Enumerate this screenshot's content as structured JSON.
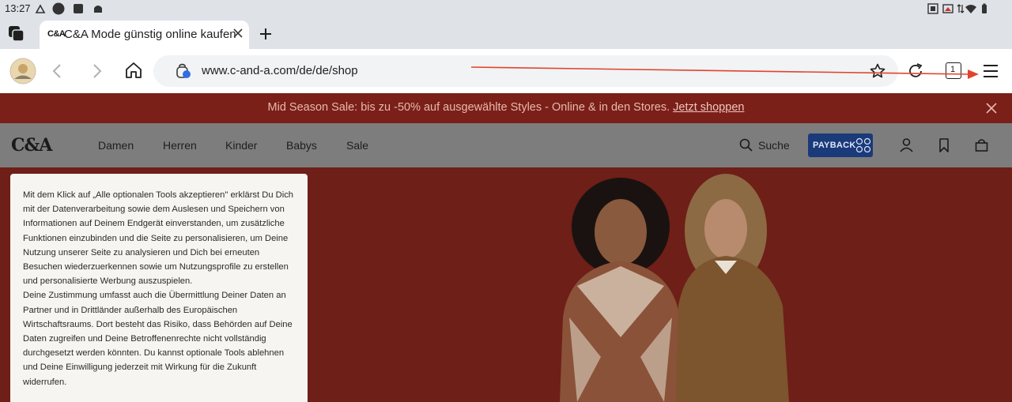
{
  "status_bar": {
    "time": "13:27"
  },
  "browser": {
    "tab": {
      "favicon_text": "C&A",
      "title": "C&A Mode günstig online kaufen"
    },
    "url": "www.c-and-a.com/de/de/shop",
    "tab_count": "1"
  },
  "promo": {
    "text": "Mid Season Sale: bis zu -50% auf ausgewählte Styles - Online & in den Stores. ",
    "link": "Jetzt shoppen"
  },
  "site": {
    "logo": "C&A",
    "nav": [
      "Damen",
      "Herren",
      "Kinder",
      "Babys",
      "Sale"
    ],
    "search_label": "Suche",
    "payback_label": "PAYBACK"
  },
  "consent": {
    "para1": "Mit dem Klick auf „Alle optionalen Tools akzeptieren\" erklärst Du Dich mit der Datenverarbeitung sowie dem Auslesen und Speichern von Informationen auf Deinem Endgerät einverstanden, um zusätzliche Funktionen einzubinden und die Seite zu personalisieren, um Deine Nutzung unserer Seite zu analysieren und Dich bei erneuten Besuchen wiederzuerkennen sowie um Nutzungsprofile zu erstellen und personalisierte Werbung auszuspielen.",
    "para2": "Deine Zustimmung umfasst auch die Übermittlung Deiner Daten an Partner und in Drittländer außerhalb des Europäischen Wirtschaftsraums. Dort besteht das Risiko, dass Behörden auf Deine Daten zugreifen und Deine Betroffenenrechte nicht vollständig durchgesetzt werden könnten. Du kannst optionale Tools ablehnen und Deine Einwilligung jederzeit mit Wirkung für die Zukunft widerrufen."
  },
  "colors": {
    "promo_bg": "#7a2018",
    "hero_bg": "#6e1f17",
    "overlay_nav": "#7d7d7d",
    "payback_blue": "#1a3a7a",
    "annotation_arrow": "#e0442e"
  },
  "icons": [
    "app-switcher-icon",
    "close-icon",
    "plus-icon",
    "avatar",
    "back-icon",
    "forward-icon",
    "home-icon",
    "site-info-icon",
    "star-icon",
    "reload-icon",
    "tabs-icon",
    "menu-icon",
    "search-icon",
    "user-icon",
    "bookmark-icon",
    "bag-icon"
  ]
}
